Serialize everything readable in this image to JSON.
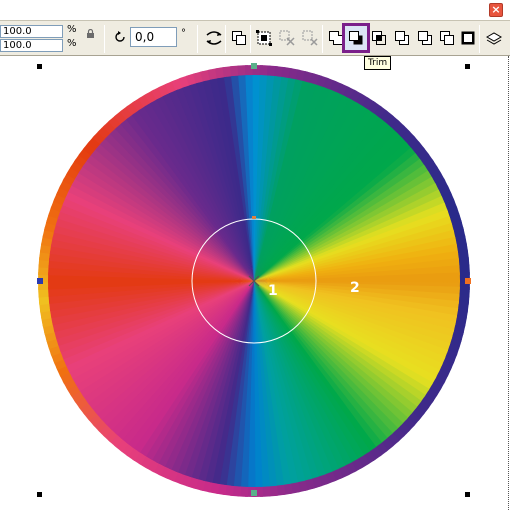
{
  "window": {
    "close_glyph": "×"
  },
  "propbar": {
    "scale_x": "100.0",
    "scale_y": "100.0",
    "scale_unit": "%",
    "angle_value": "0,0",
    "angle_unit": "°"
  },
  "tooltip": {
    "text": "Trim"
  },
  "canvas": {
    "label_1": "1",
    "label_2": "2"
  },
  "colors": {
    "toolbar_bg": "#efece1",
    "active_border": "#7a1f8a",
    "gradient": [
      "#e33a1a",
      "#e8407a",
      "#7a2a8c",
      "#3a2a8a",
      "#0090d8",
      "#00a24a",
      "#e6e020",
      "#f29a10",
      "#e85a10"
    ]
  }
}
